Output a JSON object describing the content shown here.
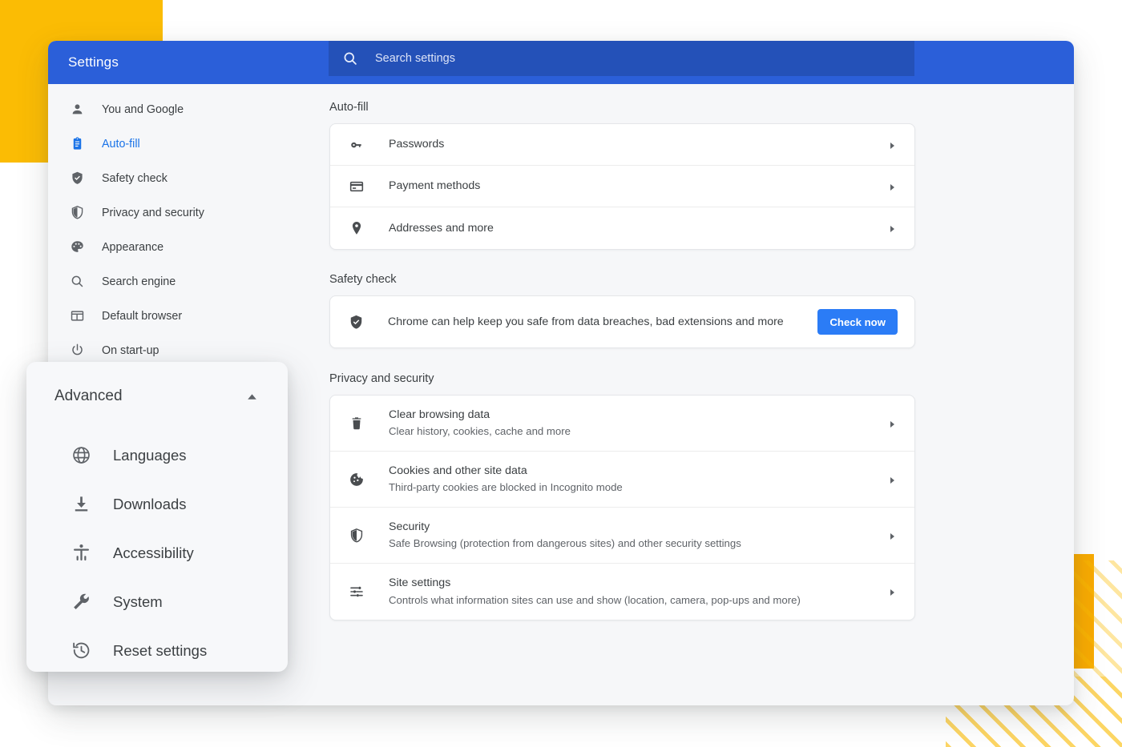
{
  "window": {
    "title": "Settings",
    "search": {
      "placeholder": "Search settings",
      "icon": "search-icon"
    }
  },
  "sidebar": {
    "items": [
      {
        "label": "You and Google",
        "icon": "person-icon",
        "active": false
      },
      {
        "label": "Auto-fill",
        "icon": "clipboard-icon",
        "active": true
      },
      {
        "label": "Safety check",
        "icon": "shield-check-icon",
        "active": false
      },
      {
        "label": "Privacy and security",
        "icon": "shield-half-icon",
        "active": false
      },
      {
        "label": "Appearance",
        "icon": "palette-icon",
        "active": false
      },
      {
        "label": "Search engine",
        "icon": "search-icon",
        "active": false
      },
      {
        "label": "Default browser",
        "icon": "browser-window-icon",
        "active": false
      },
      {
        "label": "On start-up",
        "icon": "power-icon",
        "active": false
      }
    ]
  },
  "content": {
    "autofill": {
      "heading": "Auto-fill",
      "rows": [
        {
          "title": "Passwords",
          "sub": "",
          "icon": "key-icon"
        },
        {
          "title": "Payment methods",
          "sub": "",
          "icon": "credit-card-icon"
        },
        {
          "title": "Addresses and more",
          "sub": "",
          "icon": "location-pin-icon"
        }
      ]
    },
    "safety_check": {
      "heading": "Safety check",
      "icon": "shield-check-icon",
      "message": "Chrome can help keep you safe from data breaches, bad extensions and more",
      "button_label": "Check now"
    },
    "privacy": {
      "heading": "Privacy and security",
      "rows": [
        {
          "title": "Clear browsing data",
          "sub": "Clear history, cookies, cache and more",
          "icon": "trash-icon"
        },
        {
          "title": "Cookies and other site data",
          "sub": "Third-party cookies are blocked in Incognito mode",
          "icon": "cookie-icon"
        },
        {
          "title": "Security",
          "sub": "Safe Browsing (protection from dangerous sites) and other security settings",
          "icon": "shield-half-icon"
        },
        {
          "title": "Site settings",
          "sub": "Controls what information sites can use and show (location, camera, pop-ups and more)",
          "icon": "sliders-icon"
        }
      ]
    }
  },
  "advanced_panel": {
    "title": "Advanced",
    "collapse_icon": "caret-up-icon",
    "items": [
      {
        "label": "Languages",
        "icon": "globe-icon"
      },
      {
        "label": "Downloads",
        "icon": "download-icon"
      },
      {
        "label": "Accessibility",
        "icon": "accessibility-icon"
      },
      {
        "label": "System",
        "icon": "wrench-icon"
      },
      {
        "label": "Reset settings",
        "icon": "history-restore-icon"
      }
    ]
  },
  "colors": {
    "titlebar_blue": "#2b5fd9",
    "search_blue": "#2451b8",
    "accent_blue": "#1a73e8",
    "button_blue": "#2b7cf6",
    "decor_yellow": "#fbbc04",
    "decor_yellow_bar": "#f9ab00",
    "window_bg": "#f6f7f9",
    "card_bg": "#ffffff"
  }
}
